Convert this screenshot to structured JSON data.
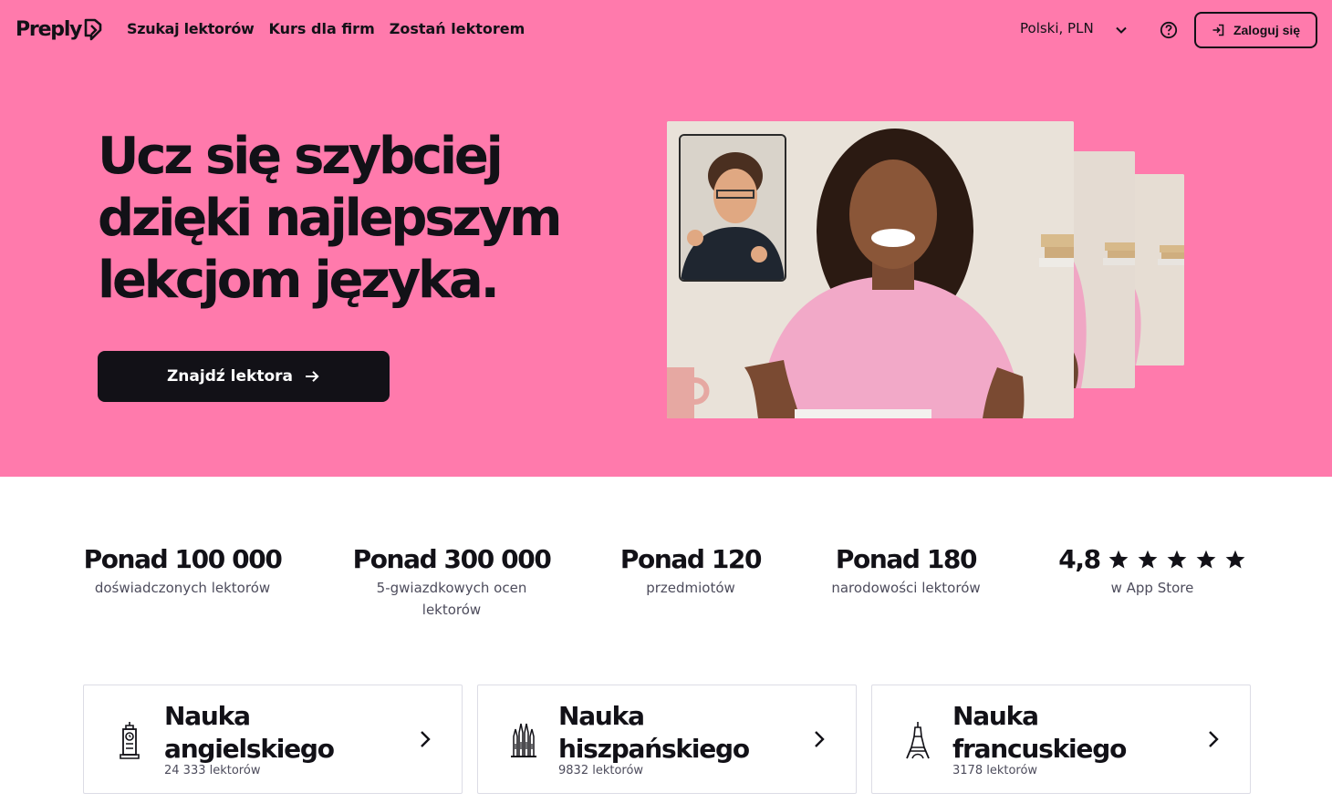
{
  "header": {
    "logo_text": "Preply",
    "nav": [
      "Szukaj lektorów",
      "Kurs dla firm",
      "Zostań lektorem"
    ],
    "language_currency": "Polski, PLN",
    "login_label": "Zaloguj się"
  },
  "hero": {
    "headline_lines": [
      "Ucz się szybciej",
      "dzięki najlepszym",
      "lekcjom języka."
    ],
    "cta_label": "Znajdź lektora",
    "background_color": "#ff7aac"
  },
  "stats": [
    {
      "value": "Ponad 100 000",
      "label": "doświadczonych lektorów"
    },
    {
      "value": "Ponad 300 000",
      "label": "5-gwiazdkowych ocen lektorów"
    },
    {
      "value": "Ponad 120",
      "label": "przedmiotów"
    },
    {
      "value": "Ponad 180",
      "label": "narodowości lektorów"
    },
    {
      "value": "4,8",
      "label": "w App Store",
      "stars": 5
    }
  ],
  "courses": [
    {
      "title_line1": "Nauka",
      "title_line2": "angielskiego",
      "tutors": "24 333 lektorów",
      "icon": "big-ben-icon"
    },
    {
      "title_line1": "Nauka",
      "title_line2": "hiszpańskiego",
      "tutors": "9832 lektorów",
      "icon": "sagrada-familia-icon"
    },
    {
      "title_line1": "Nauka",
      "title_line2": "francuskiego",
      "tutors": "3178 lektorów",
      "icon": "eiffel-tower-icon"
    }
  ]
}
